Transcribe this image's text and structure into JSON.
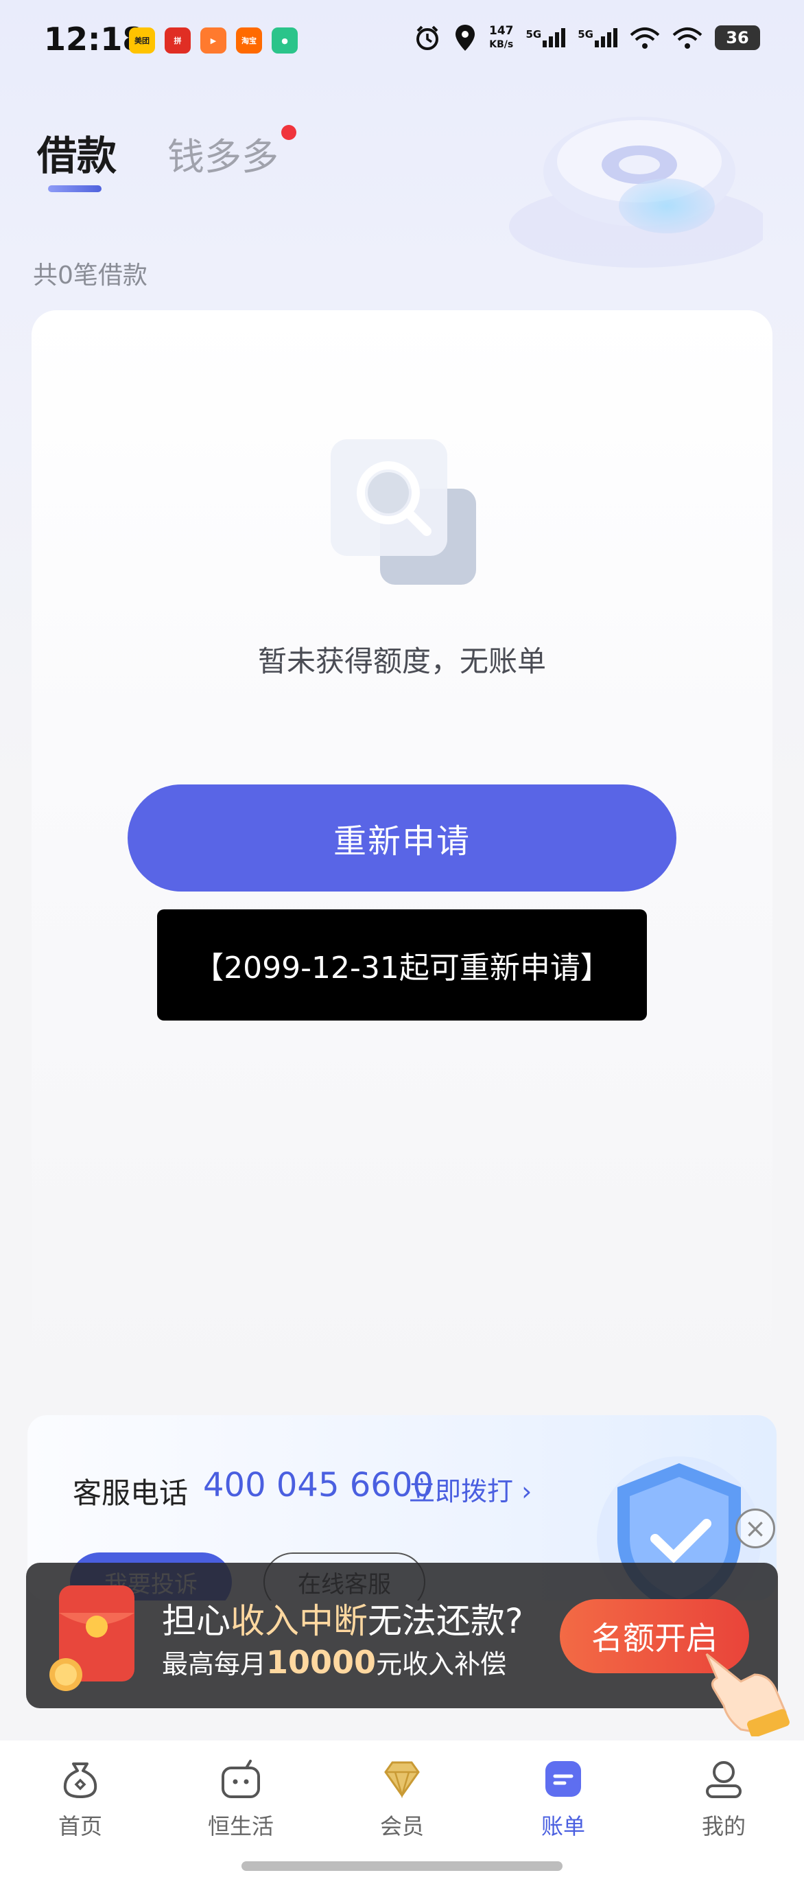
{
  "status_bar": {
    "time": "12:18",
    "app_icons": [
      {
        "name": "meituan-app-icon",
        "label": "美团",
        "color": "#ffc300"
      },
      {
        "name": "pinduoduo-app-icon",
        "label": "拼",
        "color": "#e02e24"
      },
      {
        "name": "video-app-icon",
        "label": "▶",
        "color": "#ff7a2e"
      },
      {
        "name": "taobao-flash-app-icon",
        "label": "淘宝",
        "color": "#ff6a00"
      },
      {
        "name": "wechat-mini-app-icon",
        "label": "●",
        "color": "#2bc48a"
      }
    ],
    "net_speed_value": "147",
    "net_speed_unit": "KB/s",
    "sim1": "5G",
    "sim2": "5G",
    "battery": "36"
  },
  "tabs": {
    "active": "借款",
    "second": "钱多多"
  },
  "loan_count": "共0笔借款",
  "empty_state": {
    "message": "暂未获得额度，无账单"
  },
  "reapply": {
    "button_label": "重新申请",
    "note": "【2099-12-31起可重新申请】"
  },
  "service": {
    "label": "客服电话",
    "phone": "400 045 6600",
    "call_label": "立即拨打 ›",
    "complaint_label": "我要投诉",
    "online_label": "在线客服"
  },
  "promo": {
    "title_pre": "担心",
    "title_hl": "收入中断",
    "title_post": "无法还款?",
    "sub_pre": "最高每月",
    "sub_amount": "10000",
    "sub_post": "元收入补偿",
    "button_label": "名额开启",
    "close_symbol": "×"
  },
  "bottom_nav": {
    "items": [
      {
        "label": "首页",
        "icon": "money-bag-icon"
      },
      {
        "label": "恒生活",
        "icon": "tv-mascot-icon"
      },
      {
        "label": "会员",
        "icon": "diamond-icon"
      },
      {
        "label": "账单",
        "icon": "bill-icon",
        "active": true
      },
      {
        "label": "我的",
        "icon": "user-icon"
      }
    ]
  },
  "colors": {
    "accent": "#5965e6",
    "tab_dot": "#f0343c",
    "promo_button": "#ea4b3b"
  }
}
